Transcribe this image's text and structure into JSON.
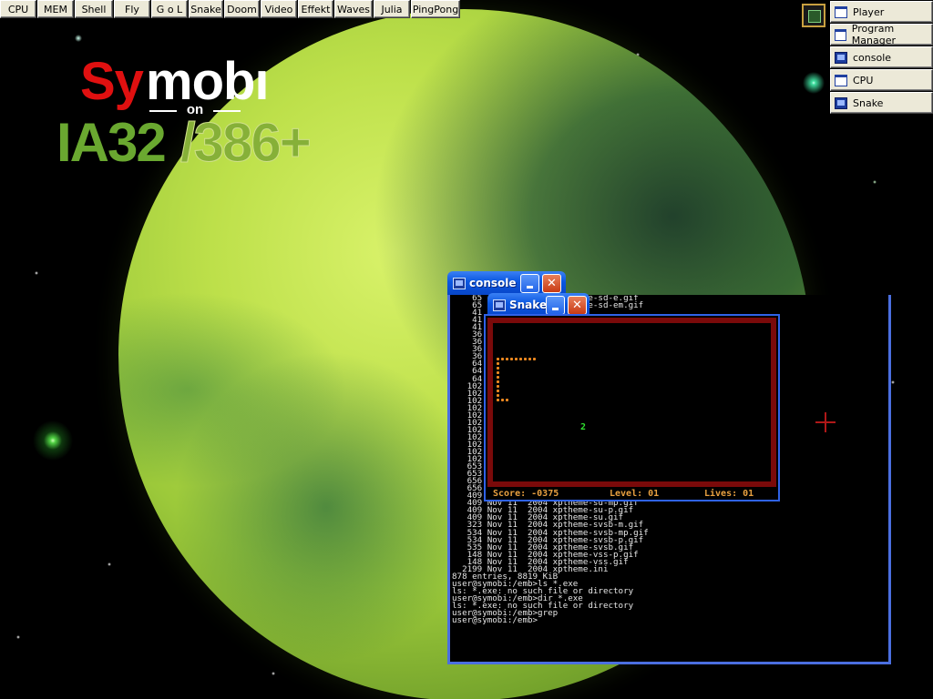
{
  "launchbar": {
    "buttons": [
      "CPU",
      "MEM",
      "Shell",
      "Fly",
      "G o L",
      "Snake",
      "Doom",
      "Video",
      "Effekt",
      "Waves",
      "Julia",
      "PingPong"
    ]
  },
  "logo": {
    "sy": "Sy",
    "mobi": "mobı",
    "on": "on",
    "ia32": "IA32",
    "cpu": "/386+"
  },
  "tasklist": {
    "items": [
      {
        "label": "Player",
        "icon": "window-icon"
      },
      {
        "label": "Program Manager",
        "icon": "window-icon"
      },
      {
        "label": "console",
        "icon": "terminal-icon"
      },
      {
        "label": "CPU",
        "icon": "window-icon"
      },
      {
        "label": "Snake",
        "icon": "terminal-icon"
      }
    ]
  },
  "console": {
    "title": "console",
    "lines_top": [
      "    65                    me-sd-e.gif",
      "    65                    me-sd-em.gif"
    ],
    "left_column": [
      "41",
      "41",
      "41",
      "36",
      "36",
      "36",
      "36",
      "64",
      "64",
      "64",
      "102",
      "102",
      "102",
      "102",
      "102",
      "102",
      "102",
      "102",
      "102",
      "102",
      "102"
    ],
    "lines": [
      "   653 Nov 11  2004 xptheme-su-e.gif",
      "   653 Nov 11  2004 xptheme-su-em.gif",
      "   656 Nov 11  2004 xptheme-su-emp.gif",
      "   656 Nov 11  2004 xptheme-su-ep.gif",
      "   409 Nov 11  2004 xptheme-su-m.gif",
      "   409 Nov 11  2004 xptheme-su-mp.gif",
      "   409 Nov 11  2004 xptheme-su-p.gif",
      "   409 Nov 11  2004 xptheme-su.gif",
      "   323 Nov 11  2004 xptheme-svsb-m.gif",
      "   534 Nov 11  2004 xptheme-svsb-mp.gif",
      "   534 Nov 11  2004 xptheme-svsb-p.gif",
      "   535 Nov 11  2004 xptheme-svsb.gif",
      "   148 Nov 11  2004 xptheme-vss-p.gif",
      "   148 Nov 11  2004 xptheme-vss.gif",
      "  2199 Nov 11  2004 xptheme.ini",
      "878 entries, 8819 KiB",
      "user@symobi:/emb>ls *.exe",
      "ls: *.exe: no such file or directory",
      "user@symobi:/emb>dir *.exe",
      "ls: *.exe: no such file or directory",
      "user@symobi:/emb>grep",
      "user@symobi:/emb>"
    ]
  },
  "snake": {
    "title": "Snake",
    "food": "2",
    "status": {
      "score": "Score: -0375",
      "level": "Level: 01",
      "lives": "Lives: 01"
    }
  },
  "colors": {
    "title_blue": "#0a56e0",
    "close_red": "#c83a14",
    "snake_border": "#7a0a0a",
    "snake_body": "#f08a20",
    "food_green": "#2fe02f"
  }
}
